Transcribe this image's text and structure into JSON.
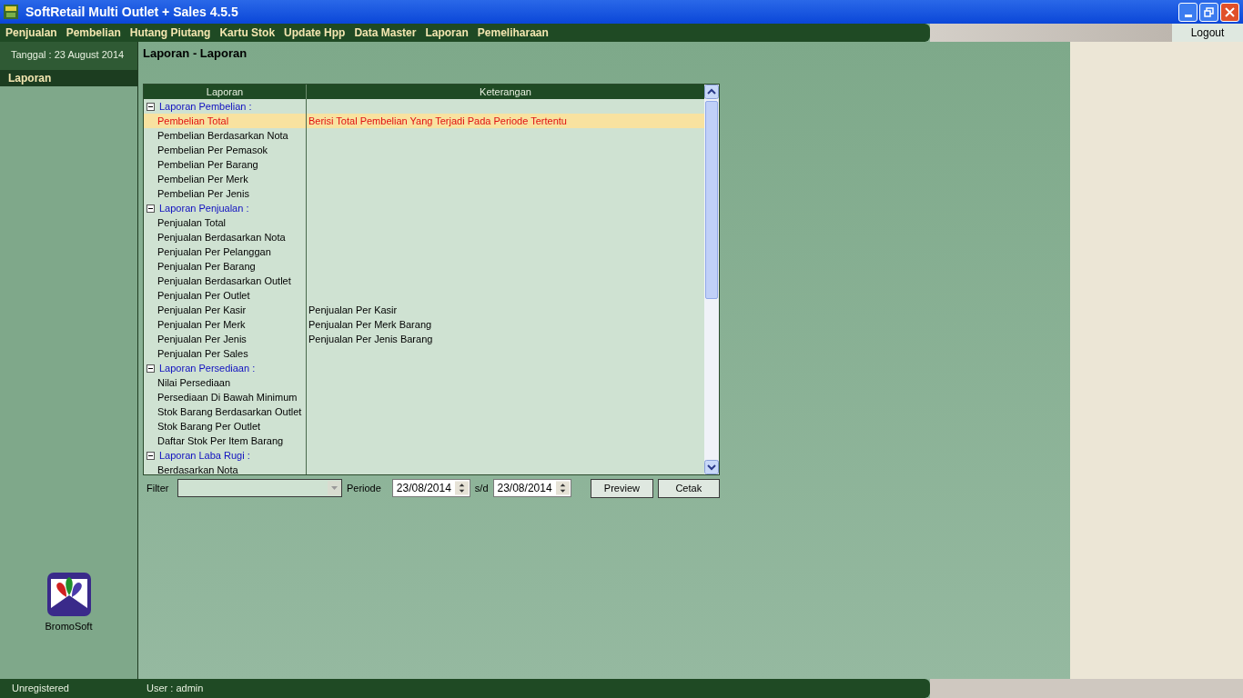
{
  "window": {
    "title": "SoftRetail Multi Outlet + Sales 4.5.5"
  },
  "menu": [
    "Penjualan",
    "Pembelian",
    "Hutang Piutang",
    "Kartu Stok",
    "Update Hpp",
    "Data Master",
    "Laporan",
    "Pemeliharaan"
  ],
  "logout": "Logout",
  "sidebar": {
    "date": "Tanggal : 23 August 2014",
    "items": [
      {
        "label": "Laporan",
        "selected": true
      }
    ],
    "logo_caption": "BromoSoft"
  },
  "page_title": "Laporan - Laporan",
  "report_table": {
    "columns": [
      "Laporan",
      "Keterangan"
    ],
    "groups": [
      {
        "label": "Laporan Pembelian :",
        "expanded": true,
        "children": [
          {
            "label": "Pembelian Total",
            "description": "Berisi Total Pembelian Yang Terjadi Pada Periode Tertentu",
            "selected": true
          },
          {
            "label": "Pembelian Berdasarkan Nota",
            "selected": false
          },
          {
            "label": "Pembelian Per Pemasok",
            "selected": false
          },
          {
            "label": "Pembelian Per Barang",
            "selected": false
          },
          {
            "label": "Pembelian Per Merk",
            "selected": false
          },
          {
            "label": "Pembelian Per Jenis",
            "selected": false
          }
        ]
      },
      {
        "label": "Laporan Penjualan :",
        "expanded": true,
        "children": [
          {
            "label": "Penjualan Total",
            "selected": false
          },
          {
            "label": "Penjualan Berdasarkan Nota",
            "selected": false
          },
          {
            "label": "Penjualan Per Pelanggan",
            "selected": false
          },
          {
            "label": "Penjualan Per Barang",
            "selected": false
          },
          {
            "label": "Penjualan Berdasarkan Outlet",
            "selected": false
          },
          {
            "label": "Penjualan Per Outlet",
            "selected": false
          },
          {
            "label": "Penjualan Per Kasir",
            "description": "Penjualan Per Kasir",
            "selected": false
          },
          {
            "label": "Penjualan Per Merk",
            "description": "Penjualan Per Merk Barang",
            "selected": false
          },
          {
            "label": "Penjualan Per Jenis",
            "description": "Penjualan Per Jenis Barang",
            "selected": false
          },
          {
            "label": "Penjualan Per Sales",
            "selected": false
          }
        ]
      },
      {
        "label": "Laporan Persediaan :",
        "expanded": true,
        "children": [
          {
            "label": "Nilai Persediaan",
            "selected": false
          },
          {
            "label": "Persediaan Di Bawah Minimum",
            "selected": false
          },
          {
            "label": "Stok Barang Berdasarkan Outlet",
            "selected": false
          },
          {
            "label": "Stok Barang Per Outlet",
            "selected": false
          },
          {
            "label": "Daftar Stok Per Item Barang",
            "selected": false
          }
        ]
      },
      {
        "label": "Laporan Laba Rugi :",
        "expanded": true,
        "children": [
          {
            "label": "Berdasarkan Nota",
            "selected": false
          }
        ]
      }
    ]
  },
  "filter": {
    "label": "Filter",
    "periode_label": "Periode",
    "date_from": "23/08/2014",
    "separator": "s/d",
    "date_to": "23/08/2014"
  },
  "buttons": [
    "Preview",
    "Cetak"
  ],
  "status_bar": [
    "Unregistered",
    "User : admin"
  ]
}
